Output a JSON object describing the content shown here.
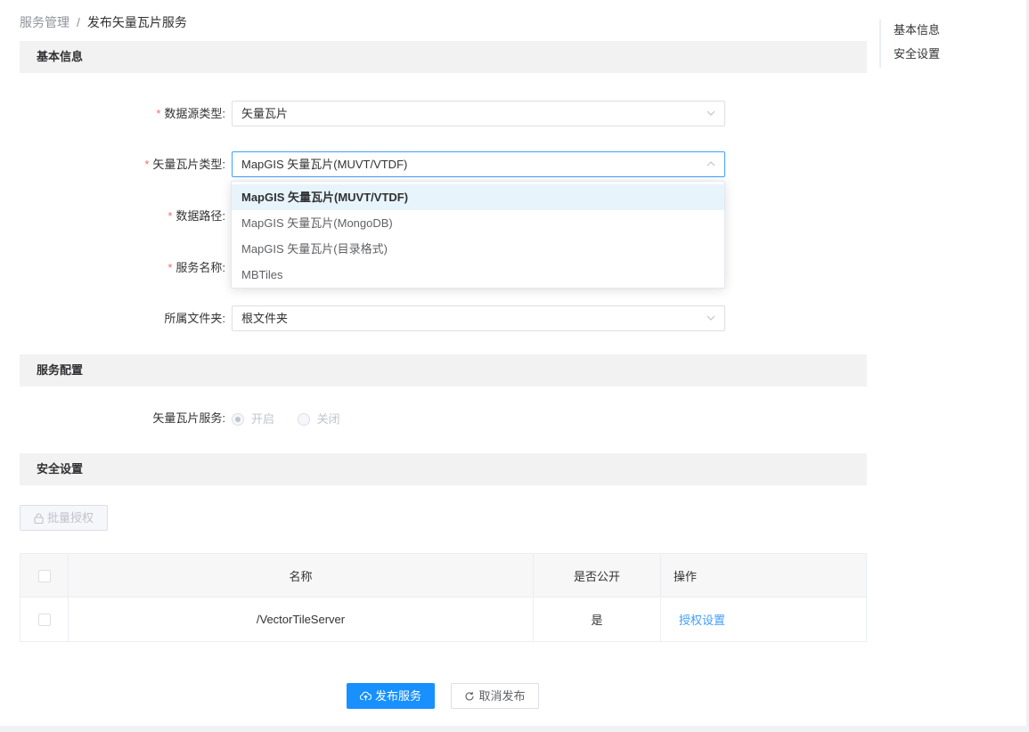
{
  "breadcrumb": {
    "parent": "服务管理",
    "separator": "/",
    "current": "发布矢量瓦片服务"
  },
  "sections": {
    "basic_info": "基本信息",
    "service_config": "服务配置",
    "security": "安全设置"
  },
  "form": {
    "datasource_type": {
      "label": "数据源类型:",
      "value": "矢量瓦片"
    },
    "tile_type": {
      "label": "矢量瓦片类型:",
      "value": "MapGIS 矢量瓦片(MUVT/VTDF)"
    },
    "data_path": {
      "label": "数据路径:"
    },
    "service_name": {
      "label": "服务名称:"
    },
    "folder": {
      "label": "所属文件夹:",
      "value": "根文件夹"
    },
    "required_mark": "*"
  },
  "dropdown": {
    "options": [
      "MapGIS 矢量瓦片(MUVT/VTDF)",
      "MapGIS 矢量瓦片(MongoDB)",
      "MapGIS 矢量瓦片(目录格式)",
      "MBTiles"
    ],
    "selected_index": 0
  },
  "service_config": {
    "label": "矢量瓦片服务:",
    "options": [
      "开启",
      "关闭"
    ],
    "selected": "开启"
  },
  "security": {
    "batch_button": "批量授权",
    "table": {
      "headers": [
        "名称",
        "是否公开",
        "操作"
      ],
      "rows": [
        {
          "name": "/VectorTileServer",
          "public": "是",
          "action": "授权设置"
        }
      ]
    }
  },
  "actions": {
    "publish": "发布服务",
    "cancel": "取消发布"
  },
  "anchor_nav": [
    "基本信息",
    "安全设置"
  ],
  "colors": {
    "primary": "#1890ff",
    "link": "#409eff",
    "required": "#f56c6c",
    "section_bg": "#f2f2f2"
  }
}
